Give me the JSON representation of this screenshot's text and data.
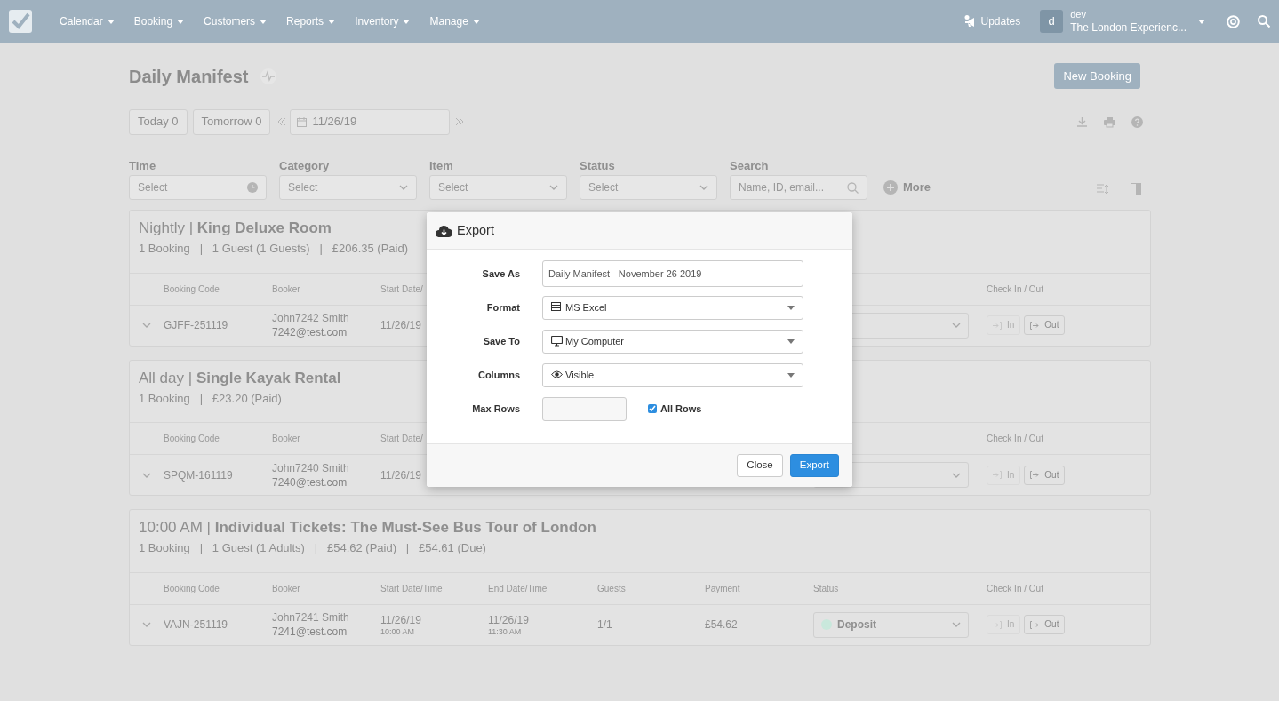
{
  "nav": {
    "menus": [
      "Calendar",
      "Booking",
      "Customers",
      "Reports",
      "Inventory",
      "Manage"
    ],
    "updates": "Updates",
    "user": {
      "initial": "d",
      "name": "dev",
      "org": "The London Experienc..."
    }
  },
  "page": {
    "title": "Daily Manifest",
    "new_booking": "New Booking",
    "quick": [
      "Today 0",
      "Tomorrow 0"
    ],
    "date": "11/26/19",
    "filters": [
      {
        "label": "Time",
        "kind": "time",
        "placeholder": "Select"
      },
      {
        "label": "Category",
        "kind": "select",
        "placeholder": "Select"
      },
      {
        "label": "Item",
        "kind": "select",
        "placeholder": "Select"
      },
      {
        "label": "Status",
        "kind": "select",
        "placeholder": "Select"
      },
      {
        "label": "Search",
        "kind": "search",
        "placeholder": "Name, ID, email..."
      }
    ],
    "more": "More"
  },
  "groups": [
    {
      "title": "Nightly | **King Deluxe Room**",
      "summary": "1 Booking   |   1 Guest (1 Guests)   |   £206.35 (Paid)",
      "columns": [
        {
          "kind": "code",
          "label": "Booking Code"
        },
        {
          "kind": "booker",
          "label": "Booker"
        },
        {
          "kind": "start",
          "label": "Start Date/"
        },
        {
          "kind": "check",
          "label": "Check In / Out"
        }
      ],
      "rows": [
        {
          "code": "GJFF-251119",
          "booker": "John7242 Smith",
          "email": "7242@test.com",
          "start_date": "11/26/19",
          "checkin": {
            "label": "In",
            "disabled": true
          },
          "checkout": {
            "label": "Out",
            "disabled": false
          }
        }
      ]
    },
    {
      "title": "All day | **Single Kayak Rental**",
      "summary": "1 Booking   |   £23.20 (Paid)",
      "columns": [
        {
          "kind": "code",
          "label": "Booking Code"
        },
        {
          "kind": "booker",
          "label": "Booker"
        },
        {
          "kind": "start",
          "label": "Start Date/"
        },
        {
          "kind": "check",
          "label": "Check In / Out"
        }
      ],
      "rows": [
        {
          "code": "SPQM-161119",
          "booker": "John7240 Smith",
          "email": "7240@test.com",
          "start_date": "11/26/19",
          "checkin": {
            "label": "In",
            "disabled": true
          },
          "checkout": {
            "label": "Out",
            "disabled": false
          }
        }
      ]
    },
    {
      "title": "10:00 AM | **Individual Tickets: The Must-See Bus Tour of London**",
      "summary": "1 Booking   |   1 Guest (1 Adults)   |   £54.62 (Paid)   |   £54.61 (Due)",
      "columns": [
        {
          "kind": "code",
          "label": "Booking Code"
        },
        {
          "kind": "booker",
          "label": "Booker"
        },
        {
          "kind": "start",
          "label": "Start Date/Time"
        },
        {
          "kind": "end",
          "label": "End Date/Time"
        },
        {
          "kind": "guests",
          "label": "Guests"
        },
        {
          "kind": "payment",
          "label": "Payment"
        },
        {
          "kind": "status",
          "label": "Status"
        },
        {
          "kind": "check",
          "label": "Check In / Out"
        }
      ],
      "rows": [
        {
          "code": "VAJN-251119",
          "booker": "John7241 Smith",
          "email": "7241@test.com",
          "start_date": "11/26/19",
          "start_time": "10:00 AM",
          "end_date": "11/26/19",
          "end_time": "11:30 AM",
          "guests": "1/1",
          "payment": "£54.62",
          "status": {
            "label": "Deposit",
            "color": "#c9e8dc"
          },
          "checkin": {
            "label": "In",
            "disabled": true
          },
          "checkout": {
            "label": "Out",
            "disabled": false
          }
        }
      ]
    }
  ],
  "modal": {
    "title": "Export",
    "fields": [
      {
        "label": "Save As",
        "kind": "text",
        "value": "Daily Manifest - November 26 2019"
      },
      {
        "label": "Format",
        "kind": "select",
        "value": "MS Excel"
      },
      {
        "label": "Save To",
        "kind": "select",
        "value": "My Computer"
      },
      {
        "label": "Columns",
        "kind": "select",
        "value": "Visible"
      },
      {
        "label": "Max Rows",
        "kind": "number",
        "checkbox": {
          "label": "All Rows",
          "checked": true
        }
      }
    ],
    "buttons": [
      {
        "label": "Close",
        "kind": "secondary"
      },
      {
        "label": "Export",
        "kind": "primary"
      }
    ]
  }
}
